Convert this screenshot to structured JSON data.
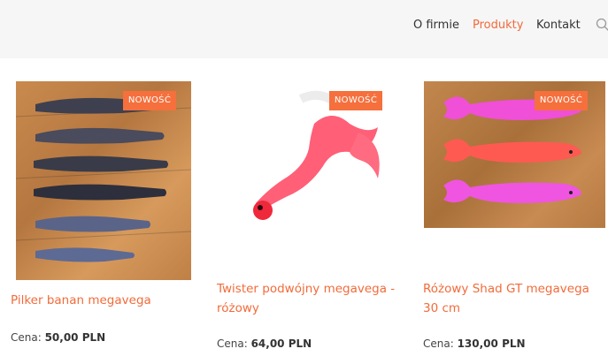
{
  "nav": {
    "items": [
      "O firmie",
      "Produkty",
      "Kontakt"
    ],
    "active": "Produkty",
    "search_icon": "search-icon"
  },
  "colors": {
    "accent": "#f26b3a",
    "badge": "#f5703d",
    "header_bg": "#f6f6f6"
  },
  "products": [
    {
      "badge": "NOWOŚĆ",
      "title": "Pilker banan megavega",
      "price_label": "Cena: ",
      "price": "50,00 PLN"
    },
    {
      "badge": "NOWOŚĆ",
      "title": "Twister podwójny megavega - różowy",
      "price_label": "Cena: ",
      "price": "64,00 PLN"
    },
    {
      "badge": "NOWOŚĆ",
      "title": "Różowy Shad GT megavega 30 cm",
      "price_label": "Cena: ",
      "price": "130,00 PLN"
    }
  ]
}
